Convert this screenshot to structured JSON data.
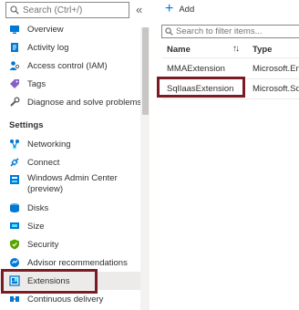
{
  "sidebar": {
    "search_placeholder": "Search (Ctrl+/)",
    "collapse_glyph": "«",
    "settings_header": "Settings",
    "items": [
      {
        "label": "Overview",
        "icon": "overview-icon"
      },
      {
        "label": "Activity log",
        "icon": "activity-log-icon"
      },
      {
        "label": "Access control (IAM)",
        "icon": "access-control-icon"
      },
      {
        "label": "Tags",
        "icon": "tag-icon"
      },
      {
        "label": "Diagnose and solve problems",
        "icon": "wrench-icon"
      }
    ],
    "settings_items": [
      {
        "label": "Networking",
        "icon": "networking-icon"
      },
      {
        "label": "Connect",
        "icon": "connect-icon"
      },
      {
        "label": "Windows Admin Center (preview)",
        "icon": "admin-center-icon"
      },
      {
        "label": "Disks",
        "icon": "disks-icon"
      },
      {
        "label": "Size",
        "icon": "size-icon"
      },
      {
        "label": "Security",
        "icon": "shield-icon"
      },
      {
        "label": "Advisor recommendations",
        "icon": "advisor-icon"
      },
      {
        "label": "Extensions",
        "icon": "extensions-icon"
      },
      {
        "label": "Continuous delivery",
        "icon": "continuous-delivery-icon"
      }
    ],
    "selected": "Extensions"
  },
  "toolbar": {
    "add_label": "Add"
  },
  "filter": {
    "placeholder": "Search to filter items..."
  },
  "table": {
    "columns": [
      "Name",
      "Type"
    ],
    "sort_glyph": "↑↓",
    "rows": [
      {
        "name": "MMAExtension",
        "type": "Microsoft.Ente"
      },
      {
        "name": "SqlIaasExtension",
        "type": "Microsoft.SqlS"
      }
    ]
  },
  "colors": {
    "highlight_border": "#7b1c25",
    "accent": "#0078d4",
    "selected_bg": "#edebe9"
  }
}
